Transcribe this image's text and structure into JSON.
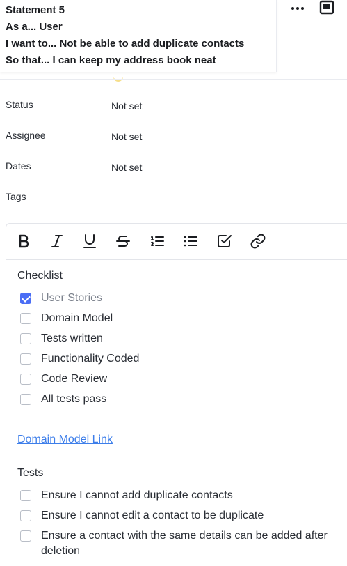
{
  "statement": {
    "title": "Statement 5",
    "as_a": "As a... User",
    "i_want": "I want to... Not be able to add duplicate contacts",
    "so_that": "So that... I can keep my address book neat"
  },
  "properties": {
    "status": {
      "label": "Status",
      "value": "Not set"
    },
    "assignee": {
      "label": "Assignee",
      "value": "Not set"
    },
    "dates": {
      "label": "Dates",
      "value": "Not set"
    },
    "tags": {
      "label": "Tags",
      "value": "—"
    }
  },
  "toolbar": {
    "icons": [
      "bold-icon",
      "italic-icon",
      "underline-icon",
      "strikethrough-icon",
      "numbered-list-icon",
      "bullet-list-icon",
      "checklist-icon",
      "link-icon"
    ]
  },
  "checklist": {
    "heading": "Checklist",
    "items": [
      {
        "label": "User Stories",
        "checked": true
      },
      {
        "label": "Domain Model",
        "checked": false
      },
      {
        "label": "Tests written",
        "checked": false
      },
      {
        "label": "Functionality Coded",
        "checked": false
      },
      {
        "label": "Code Review",
        "checked": false
      },
      {
        "label": "All tests pass",
        "checked": false
      }
    ]
  },
  "domain_link": "Domain Model Link",
  "tests": {
    "heading": "Tests",
    "items": [
      {
        "label": "Ensure I cannot add duplicate contacts",
        "checked": false
      },
      {
        "label": "Ensure I cannot edit a contact to be duplicate",
        "checked": false
      },
      {
        "label": "Ensure a contact with the same details can be added after deletion",
        "checked": false
      }
    ]
  },
  "colors": {
    "accent": "#4b6ef5",
    "link": "#3d7eea",
    "text": "#292d34",
    "border": "#e3e5ea"
  }
}
